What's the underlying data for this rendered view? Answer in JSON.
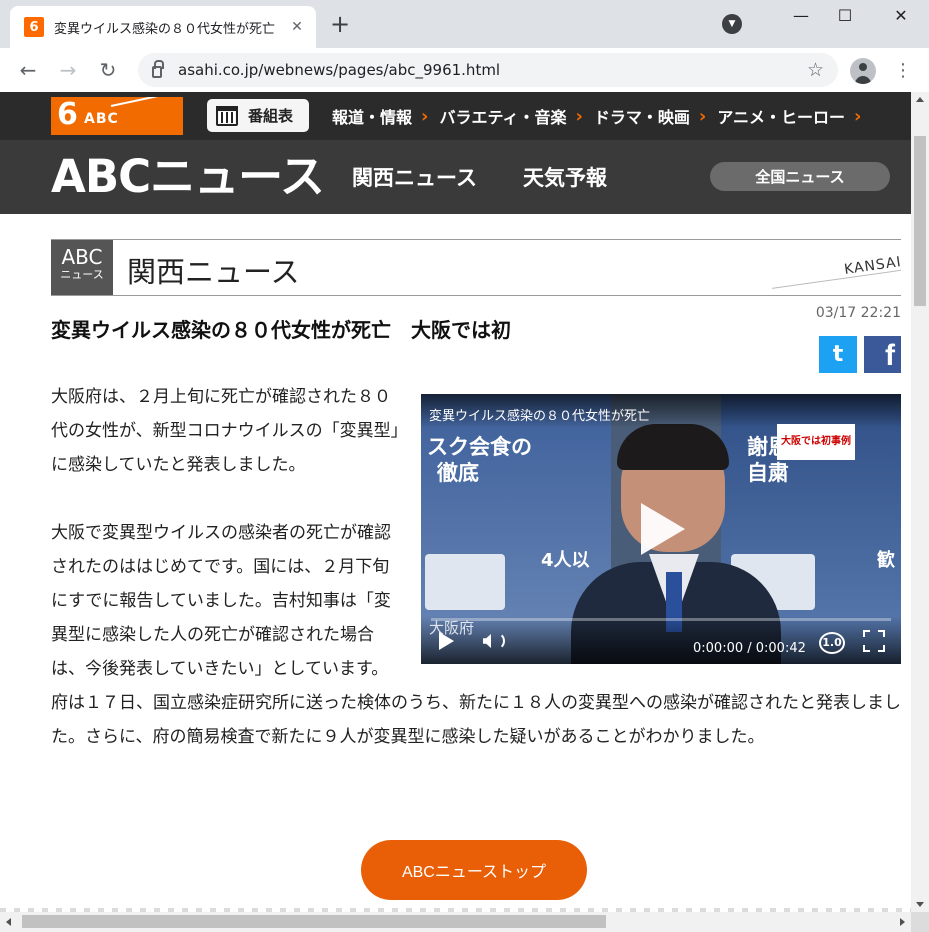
{
  "browser": {
    "tab_title": "変異ウイルス感染の８０代女性が死亡",
    "favicon_text": "6",
    "url": "asahi.co.jp/webnews/pages/abc_9961.html"
  },
  "site": {
    "logo_number": "6",
    "logo_text": "ABC",
    "bangumi_label": "番組表",
    "top_nav": [
      "報道・情報",
      "バラエティ・音楽",
      "ドラマ・映画",
      "アニメ・ヒーロー"
    ],
    "news_logo": "ABCニュース",
    "sub_nav": [
      "関西ニュース",
      "天気予報"
    ],
    "zenkoku_label": "全国ニュース",
    "accent_color": "#f26b00"
  },
  "section": {
    "badge_line1": "ABC",
    "badge_line2": "ニュース",
    "title": "関西ニュース",
    "kansai_tag": "KANSAI"
  },
  "article": {
    "timestamp": "03/17 22:21",
    "headline": "変異ウイルス感染の８０代女性が死亡　大阪では初",
    "twitter_glyph": "t",
    "facebook_glyph": "f",
    "para1": "大阪府は、２月上旬に死亡が確認された８０代の女性が、新型コロナウイルスの「変異型」に感染していたと発表しました。",
    "para2": "大阪で変異型ウイルスの感染者の死亡が確認されたのははじめてです。国には、２月下旬にすでに報告していました。吉村知事は「変異型に感染した人の死亡が確認された場合は、今後発表していきたい」としています。府は１７日、国立感染症研究所に送った検体のうち、新たに１８人の変異型への感染が確認されたと発表しました。さらに、府の簡易検査で新たに９人が変異型に感染した疑いがあることがわかりました。"
  },
  "video": {
    "title": "変異ウイルス感染の８０代女性が死亡",
    "telop_caption": "大阪では初事例",
    "panel_left_1": "スク会食の",
    "panel_left_2": "徹底",
    "panel_right_1": "謝恩会など",
    "panel_right_2": "自粛",
    "panel_bottom": "4人以",
    "panel_far_right": "歓",
    "osaka_label": "大阪府",
    "time": "0:00:00 / 0:00:42",
    "speed": "1.0",
    "progress": 0
  },
  "footer": {
    "top_button_label": "ABCニューストップ"
  }
}
